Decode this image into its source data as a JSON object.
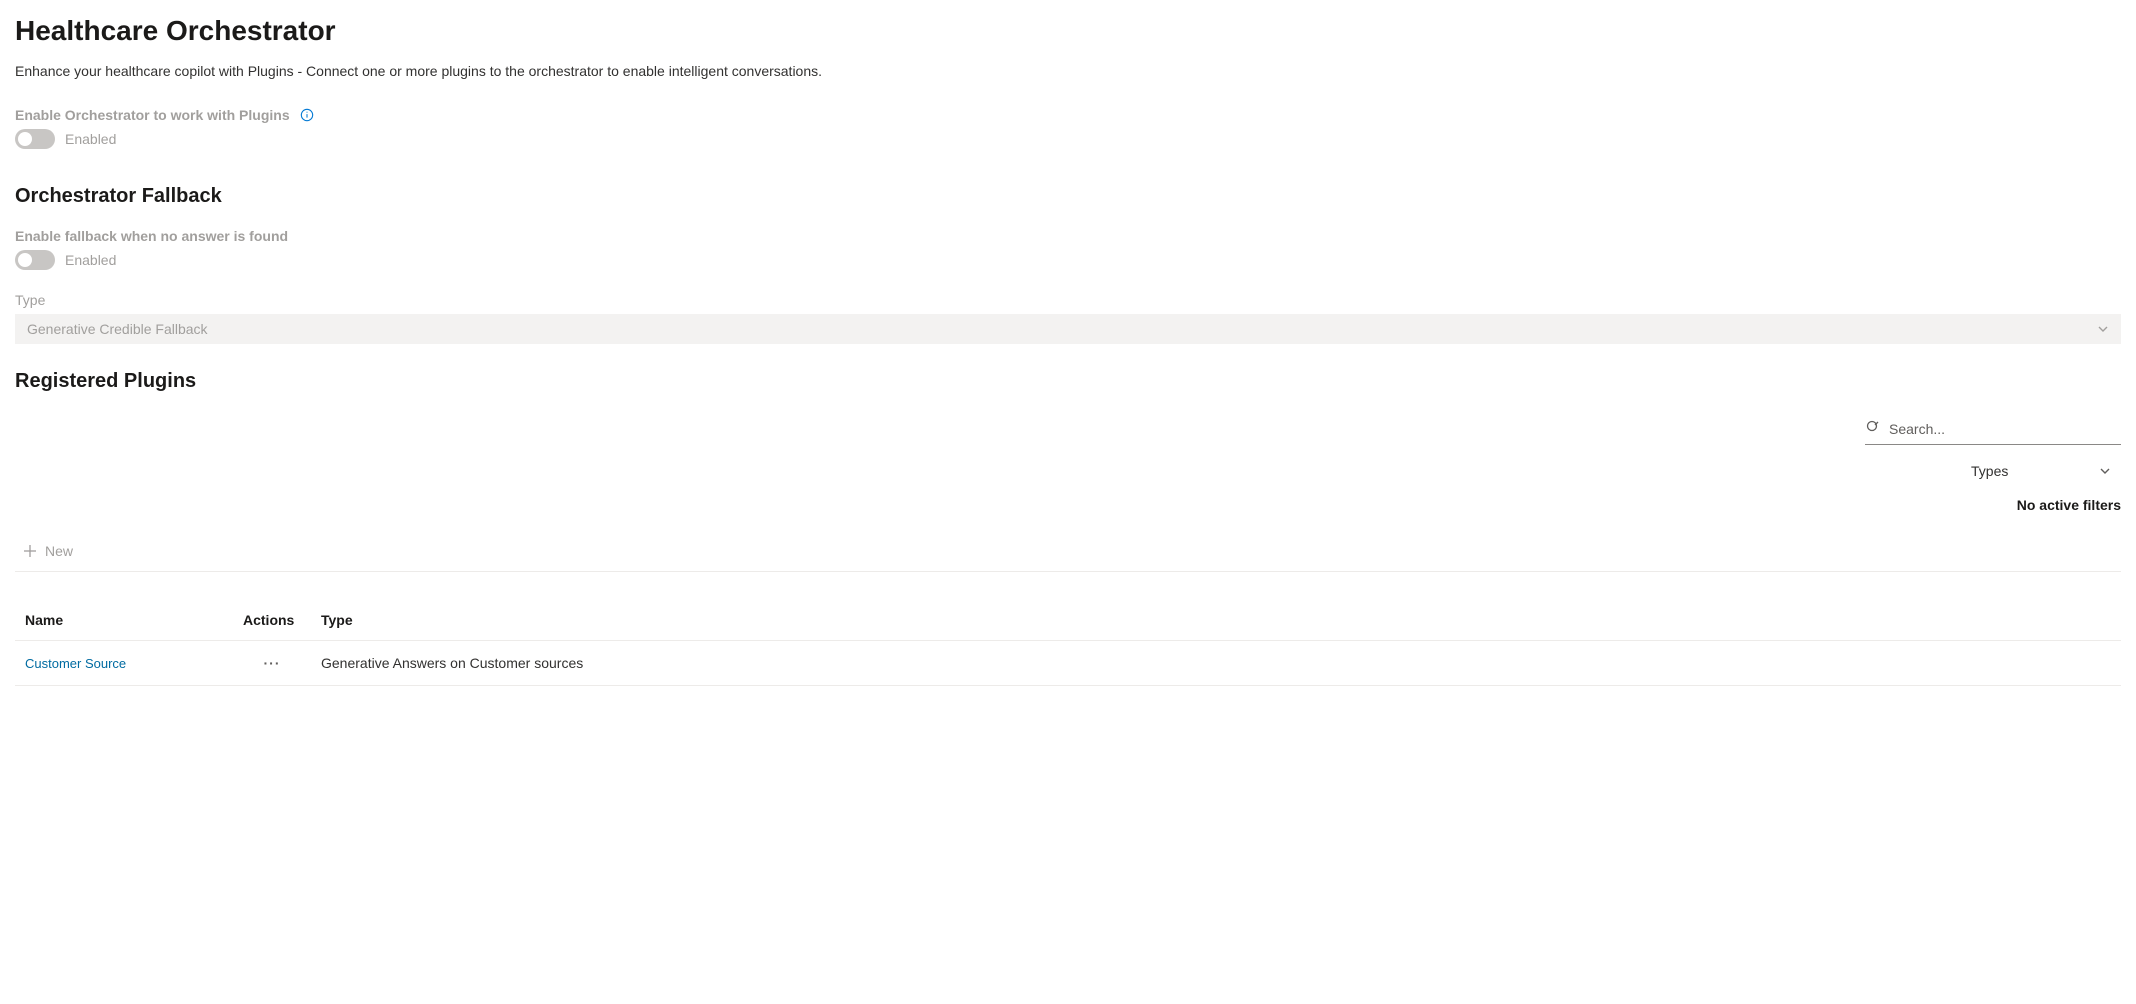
{
  "header": {
    "title": "Healthcare Orchestrator",
    "description": "Enhance your healthcare copilot with Plugins - Connect one or more plugins to the orchestrator to enable intelligent conversations."
  },
  "orchestrator": {
    "enable_label": "Enable Orchestrator to work with Plugins",
    "toggle_status": "Enabled"
  },
  "fallback": {
    "heading": "Orchestrator Fallback",
    "enable_label": "Enable fallback when no answer is found",
    "toggle_status": "Enabled",
    "type_label": "Type",
    "type_value": "Generative Credible Fallback"
  },
  "plugins": {
    "heading": "Registered Plugins",
    "search_placeholder": "Search...",
    "types_filter_label": "Types",
    "no_filters_text": "No active filters",
    "new_button": "New",
    "columns": {
      "name": "Name",
      "actions": "Actions",
      "type": "Type"
    },
    "rows": [
      {
        "name": "Customer Source",
        "type": "Generative Answers on Customer sources"
      }
    ]
  }
}
